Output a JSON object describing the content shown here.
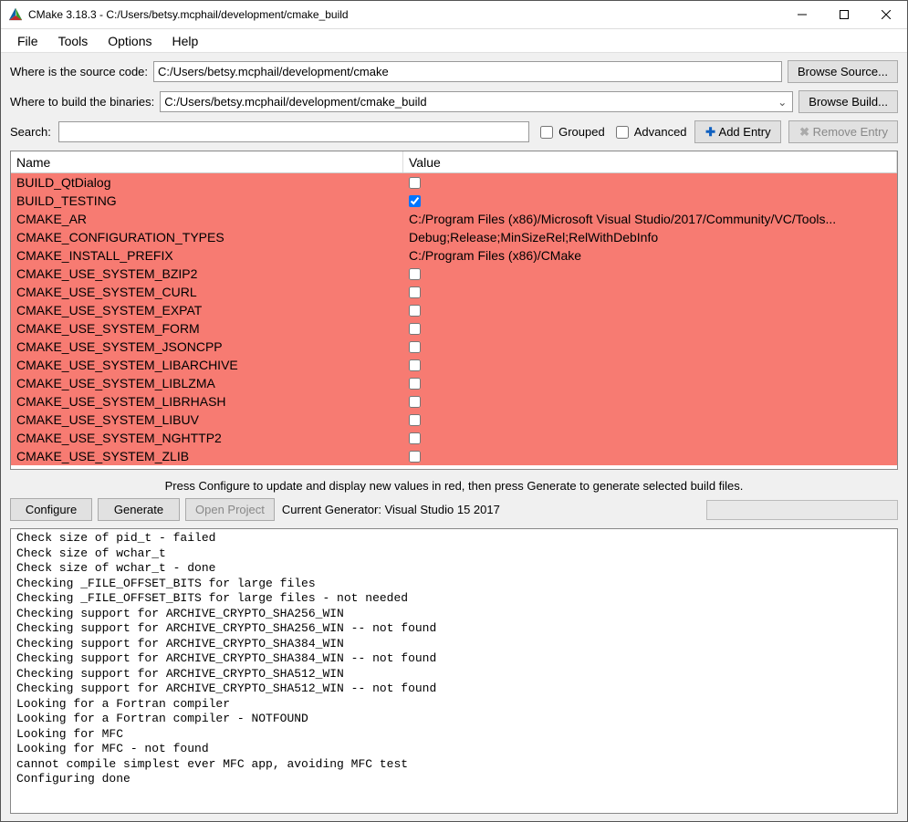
{
  "window": {
    "title": "CMake 3.18.3 - C:/Users/betsy.mcphail/development/cmake_build"
  },
  "menu": {
    "file": "File",
    "tools": "Tools",
    "options": "Options",
    "help": "Help"
  },
  "paths": {
    "source_label": "Where is the source code:",
    "source_value": "C:/Users/betsy.mcphail/development/cmake",
    "browse_source": "Browse Source...",
    "build_label": "Where to build the binaries:",
    "build_value": "C:/Users/betsy.mcphail/development/cmake_build",
    "browse_build": "Browse Build..."
  },
  "search": {
    "label": "Search:",
    "value": "",
    "grouped_label": "Grouped",
    "grouped_checked": false,
    "advanced_label": "Advanced",
    "advanced_checked": false,
    "add_entry": "Add Entry",
    "remove_entry": "Remove Entry"
  },
  "table": {
    "col_name": "Name",
    "col_value": "Value",
    "rows": [
      {
        "name": "BUILD_QtDialog",
        "type": "bool",
        "checked": false
      },
      {
        "name": "BUILD_TESTING",
        "type": "bool",
        "checked": true
      },
      {
        "name": "CMAKE_AR",
        "type": "text",
        "value": "C:/Program Files (x86)/Microsoft Visual Studio/2017/Community/VC/Tools..."
      },
      {
        "name": "CMAKE_CONFIGURATION_TYPES",
        "type": "text",
        "value": "Debug;Release;MinSizeRel;RelWithDebInfo"
      },
      {
        "name": "CMAKE_INSTALL_PREFIX",
        "type": "text",
        "value": "C:/Program Files (x86)/CMake"
      },
      {
        "name": "CMAKE_USE_SYSTEM_BZIP2",
        "type": "bool",
        "checked": false
      },
      {
        "name": "CMAKE_USE_SYSTEM_CURL",
        "type": "bool",
        "checked": false
      },
      {
        "name": "CMAKE_USE_SYSTEM_EXPAT",
        "type": "bool",
        "checked": false
      },
      {
        "name": "CMAKE_USE_SYSTEM_FORM",
        "type": "bool",
        "checked": false
      },
      {
        "name": "CMAKE_USE_SYSTEM_JSONCPP",
        "type": "bool",
        "checked": false
      },
      {
        "name": "CMAKE_USE_SYSTEM_LIBARCHIVE",
        "type": "bool",
        "checked": false
      },
      {
        "name": "CMAKE_USE_SYSTEM_LIBLZMA",
        "type": "bool",
        "checked": false
      },
      {
        "name": "CMAKE_USE_SYSTEM_LIBRHASH",
        "type": "bool",
        "checked": false
      },
      {
        "name": "CMAKE_USE_SYSTEM_LIBUV",
        "type": "bool",
        "checked": false
      },
      {
        "name": "CMAKE_USE_SYSTEM_NGHTTP2",
        "type": "bool",
        "checked": false
      },
      {
        "name": "CMAKE_USE_SYSTEM_ZLIB",
        "type": "bool",
        "checked": false
      }
    ]
  },
  "hint": "Press Configure to update and display new values in red, then press Generate to generate selected build files.",
  "actions": {
    "configure": "Configure",
    "generate": "Generate",
    "open_project": "Open Project",
    "generator_label": "Current Generator: Visual Studio 15 2017"
  },
  "log_lines": [
    "Check size of pid_t - failed",
    "Check size of wchar_t",
    "Check size of wchar_t - done",
    "Checking _FILE_OFFSET_BITS for large files",
    "Checking _FILE_OFFSET_BITS for large files - not needed",
    "Checking support for ARCHIVE_CRYPTO_SHA256_WIN",
    "Checking support for ARCHIVE_CRYPTO_SHA256_WIN -- not found",
    "Checking support for ARCHIVE_CRYPTO_SHA384_WIN",
    "Checking support for ARCHIVE_CRYPTO_SHA384_WIN -- not found",
    "Checking support for ARCHIVE_CRYPTO_SHA512_WIN",
    "Checking support for ARCHIVE_CRYPTO_SHA512_WIN -- not found",
    "Looking for a Fortran compiler",
    "Looking for a Fortran compiler - NOTFOUND",
    "Looking for MFC",
    "Looking for MFC - not found",
    "cannot compile simplest ever MFC app, avoiding MFC test",
    "Configuring done"
  ]
}
